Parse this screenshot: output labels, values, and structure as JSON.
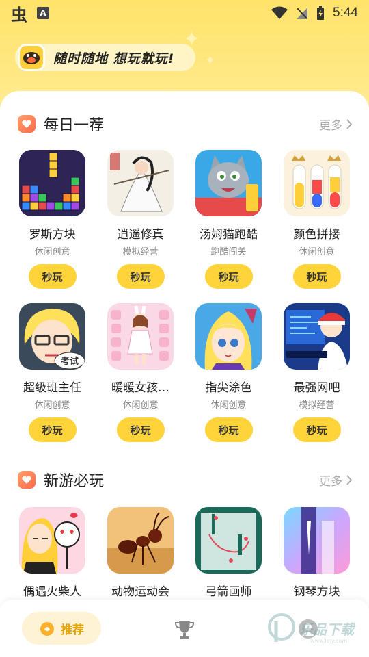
{
  "status_bar": {
    "app_glyph": "虫",
    "badge_letter": "A",
    "time": "5:44"
  },
  "banner": {
    "slogan": "随时随地 想玩就玩!"
  },
  "sections": [
    {
      "title": "每日一荐",
      "more": "更多",
      "games": [
        {
          "name": "罗斯方块",
          "tag": "休闲创意",
          "button": "秒玩"
        },
        {
          "name": "逍遥修真",
          "tag": "模拟经营",
          "button": "秒玩"
        },
        {
          "name": "汤姆猫跑酷",
          "tag": "跑酷闯关",
          "button": "秒玩"
        },
        {
          "name": "颜色拼接",
          "tag": "休闲创意",
          "button": "秒玩"
        },
        {
          "name": "超级班主任",
          "tag": "休闲创意",
          "button": "秒玩"
        },
        {
          "name": "暖暖女孩…",
          "tag": "休闲创意",
          "button": "秒玩"
        },
        {
          "name": "指尖涂色",
          "tag": "休闲创意",
          "button": "秒玩"
        },
        {
          "name": "最强网吧",
          "tag": "模拟经营",
          "button": "秒玩"
        }
      ]
    },
    {
      "title": "新游必玩",
      "more": "更多",
      "games": [
        {
          "name": "偶遇火柴人"
        },
        {
          "name": "动物运动会"
        },
        {
          "name": "弓箭画师"
        },
        {
          "name": "钢琴方块"
        }
      ]
    }
  ],
  "tabbar": {
    "active_label": "推荐",
    "icons": [
      "flame-icon",
      "trophy-icon",
      "avatar-icon"
    ]
  },
  "watermark": {
    "text": "乐品下载",
    "url": "www.lpjy.com"
  },
  "colors": {
    "accent": "#ffd43a",
    "header": "#ffe36a",
    "more_text": "#aaaaaa"
  }
}
